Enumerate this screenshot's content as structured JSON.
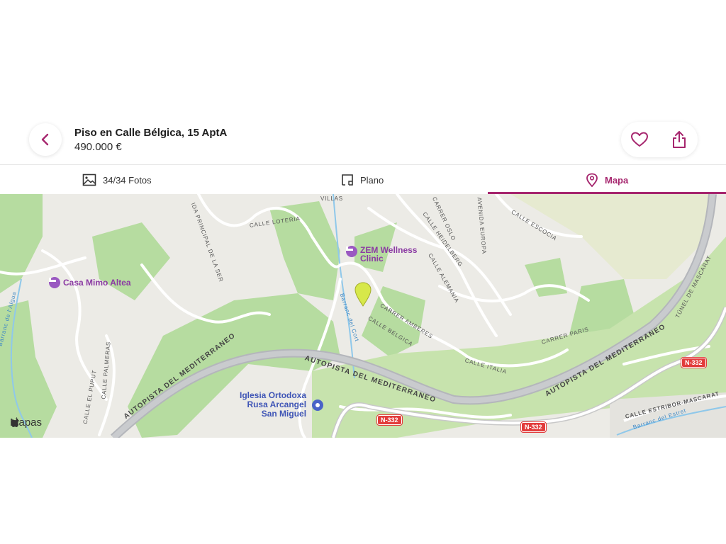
{
  "header": {
    "title": "Piso en Calle Bélgica, 15 AptA",
    "price": "490.000 €",
    "back_icon": "chevron-left-icon",
    "favorite_icon": "heart-icon",
    "share_icon": "share-icon"
  },
  "colors": {
    "accent": "#a6266e",
    "poi": "#9a59c1",
    "road_shield": "#e23c3c",
    "park": "#b6dca0"
  },
  "tabs": [
    {
      "label": "34/34 Fotos",
      "icon": "image-icon",
      "selected": false
    },
    {
      "label": "Plano",
      "icon": "floorplan-icon",
      "selected": false
    },
    {
      "label": "Mapa",
      "icon": "map-pin-icon",
      "selected": true
    }
  ],
  "map": {
    "attribution": "Mapas",
    "pois": {
      "zem": "ZEM Wellness Clinic",
      "zem_line1": "ZEM Wellness",
      "zem_line2": "Clinic",
      "casa": "Casa Mimo Altea",
      "church_line1": "Iglesia Ortodoxa",
      "church_line2": "Rusa Arcangel",
      "church_line3": "San Miguel"
    },
    "streets": {
      "principal": "IDA PRINCIPAL DE LA SER",
      "loteria": "CALLE LOTERIA",
      "villas": "VILLAS",
      "oslo": "CARRER OSLO",
      "heidelberg": "CALLE HEIDELBERG",
      "alemania": "CALLE ALEMANIA",
      "europa": "AVENIDA EUROPA",
      "escocia": "CALLE ESCOCIA",
      "amberes": "CARRER AMBERES",
      "belgica": "CALLE BELGICA",
      "italia": "CALLE ITALIA",
      "paris": "CARRER PARIS",
      "tunel": "TÚNEL DE MASCARAT",
      "autopista": "AUTOPISTA DEL MEDITERRANEO",
      "cort": "Barranc del Cort",
      "algua": "Barranc de l'Algua",
      "palmeras": "CALLE PALMERAS",
      "puput": "CALLE EL PUPUT",
      "estribor": "CALLE ESTRIBOR-MASCARAT",
      "estret": "Barranc del Estret"
    },
    "shields": [
      "N-332",
      "N-332",
      "N-332"
    ]
  }
}
